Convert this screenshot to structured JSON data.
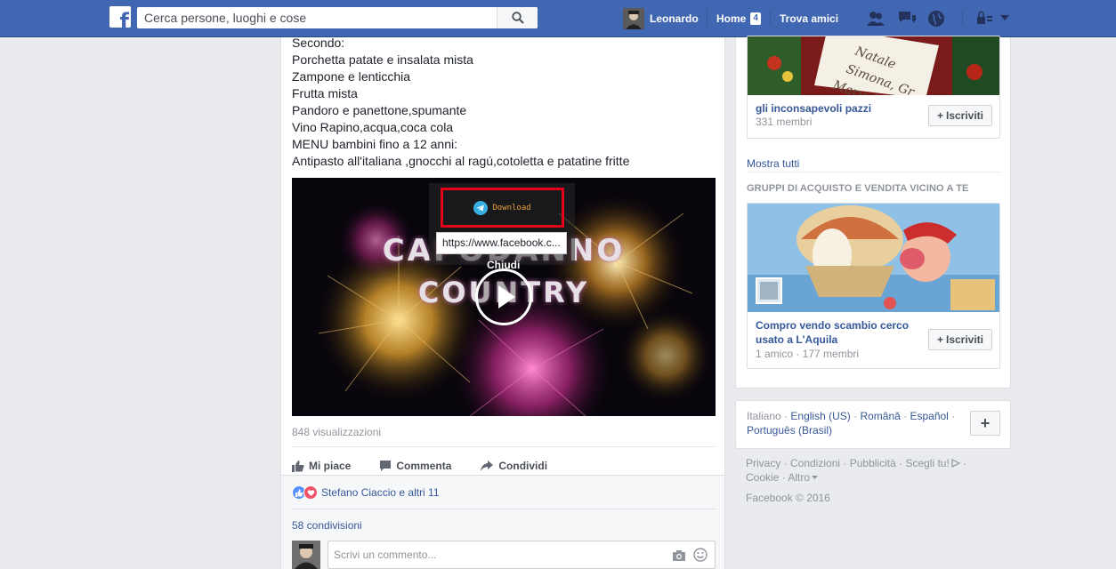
{
  "header": {
    "search_placeholder": "Cerca persone, luoghi e cose",
    "user_name": "Leonardo",
    "home_label": "Home",
    "home_badge": "4",
    "find_friends": "Trova amici"
  },
  "post": {
    "text_lines": [
      "Secondo:",
      "Porchetta patate e insalata mista",
      "Zampone e lenticchia",
      "Frutta mista",
      "Pandoro e panettone,spumante",
      "Vino Rapino,acqua,coca cola",
      "MENU bambini fino a 12 anni:",
      "Antipasto all'italiana ,gnocchi al ragú,cotoletta e patatine fritte"
    ],
    "video": {
      "title_line1": "CAPODANNO",
      "title_line2": "COUNTRY",
      "download_label": "Download",
      "url_tooltip": "https://www.facebook.c...",
      "close_label": "Chiudi"
    },
    "views": "848 visualizzazioni",
    "actions": {
      "like": "Mi piace",
      "comment": "Commenta",
      "share": "Condividi"
    },
    "reactions_text": "Stefano Ciaccio e altri 11",
    "shares_text": "58 condivisioni",
    "comment_placeholder": "Scrivi un commento..."
  },
  "sidebar": {
    "group1": {
      "name": "gli inconsapevoli pazzi",
      "meta": "331 membri",
      "join_label": "Iscriviti"
    },
    "show_all": "Mostra tutti",
    "section_title": "GRUPPI DI ACQUISTO E VENDITA VICINO A TE",
    "group2": {
      "name_line1": "Compro vendo scambio cerco",
      "name_line2": "usato a L'Aquila",
      "meta": "1 amico · 177 membri",
      "join_label": "Iscriviti"
    }
  },
  "languages": {
    "current": "Italiano",
    "options": [
      "English (US)",
      "Română",
      "Español",
      "Português (Brasil)"
    ]
  },
  "footer": {
    "links": [
      "Privacy",
      "Condizioni",
      "Pubblicità",
      "Scegli tu!",
      "Cookie",
      "Altro"
    ],
    "copyright": "Facebook © 2016"
  },
  "colors": {
    "brand_blue": "#4267b2",
    "link_blue": "#365899",
    "download_highlight": "#e2001a"
  }
}
